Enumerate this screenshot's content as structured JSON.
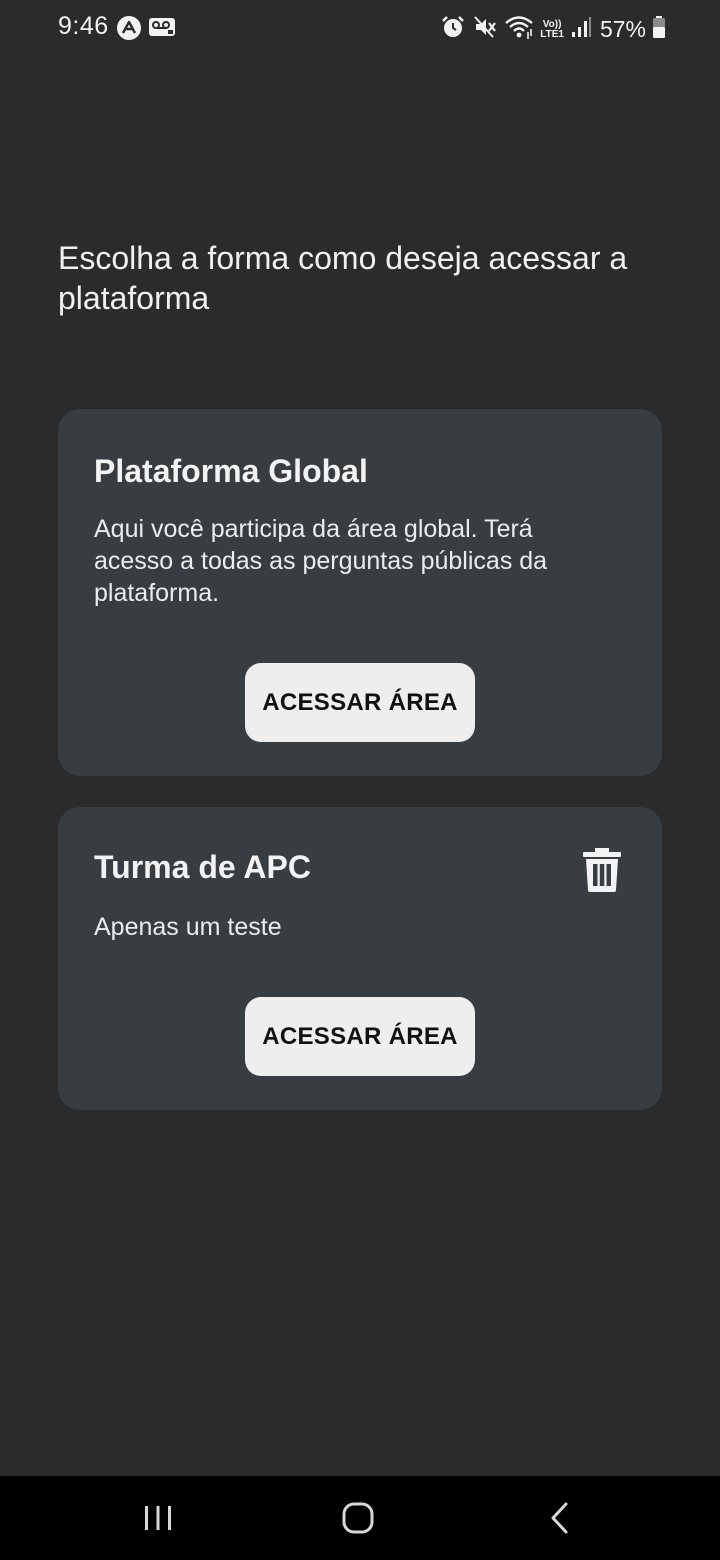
{
  "status_bar": {
    "time": "9:46",
    "battery": "57%",
    "left_icons": [
      "app-notification-icon",
      "voicemail-icon"
    ],
    "right_icons": [
      "alarm-icon",
      "mute-icon",
      "wifi-icon",
      "volte-lte-icon",
      "signal-icon",
      "battery-icon"
    ],
    "network_label_top": "Vo))",
    "network_label_bottom": "LTE1"
  },
  "heading": "Escolha a forma como deseja acessar a plataforma",
  "cards": [
    {
      "title": "Plataforma Global",
      "description": "Aqui você participa da área global. Terá acesso a todas as perguntas públicas da plataforma.",
      "button_label": "ACESSAR ÁREA"
    },
    {
      "title": "Turma de APC",
      "description": "Apenas um teste",
      "button_label": "ACESSAR ÁREA",
      "action_icon": "trash-icon"
    }
  ],
  "nav_bar": {
    "buttons": [
      "recents-icon",
      "home-icon",
      "back-icon"
    ]
  },
  "colors": {
    "background": "#2b2b2b",
    "card": "#373d41",
    "button": "#eeeeee",
    "nav_bar": "#000000"
  }
}
